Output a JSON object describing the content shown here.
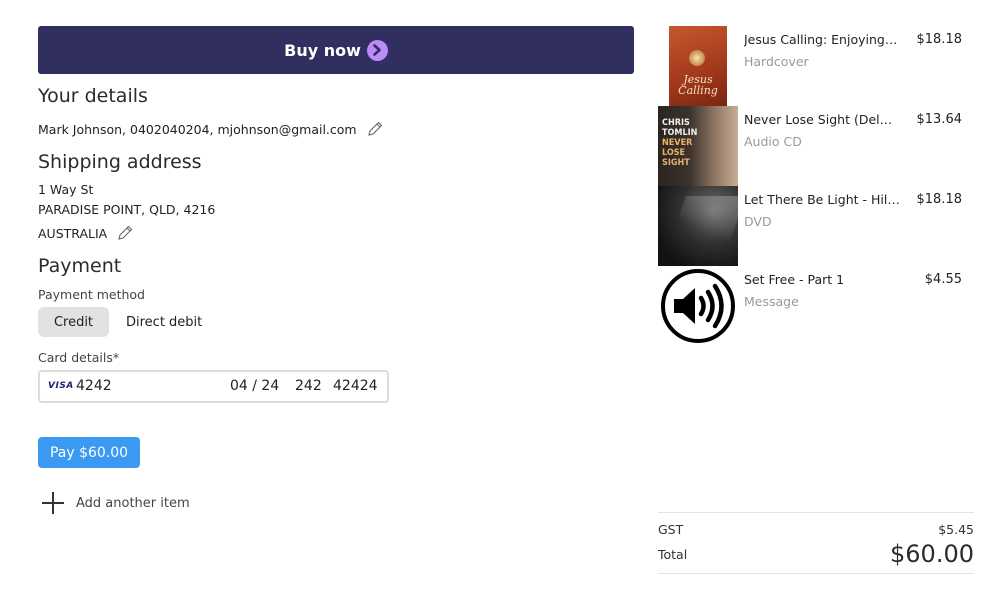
{
  "buy_button": {
    "label": "Buy now"
  },
  "details": {
    "title": "Your details",
    "contact": "Mark Johnson, 0402040204, mjohnson@gmail.com"
  },
  "shipping": {
    "title": "Shipping address",
    "line1": "1 Way St",
    "line2": "PARADISE POINT, QLD, 4216",
    "country": "AUSTRALIA"
  },
  "payment": {
    "title": "Payment",
    "method_label": "Payment method",
    "methods": [
      "Credit",
      "Direct debit"
    ],
    "selected_method": "Credit",
    "card_label": "Card details*",
    "card": {
      "brand": "VISA",
      "number": "4242",
      "expiry": "04 / 24",
      "cvc": "242",
      "postcode": "42424"
    },
    "pay_label": "Pay $60.00"
  },
  "add_item_label": "Add another item",
  "cart": {
    "items": [
      {
        "name": "Jesus Calling: Enjoying P...",
        "format": "Hardcover",
        "price": "$18.18"
      },
      {
        "name": "Never Lose Sight (Delux...",
        "format": "Audio CD",
        "price": "$13.64"
      },
      {
        "name": "Let There Be Light - Hills...",
        "format": "DVD",
        "price": "$18.18"
      },
      {
        "name": "Set Free - Part 1",
        "format": "Message",
        "price": "$4.55"
      }
    ],
    "gst_label": "GST",
    "gst_value": "$5.45",
    "total_label": "Total",
    "total_value": "$60.00",
    "cover_texts": {
      "jesus_calling": "Jesus Calling",
      "chris_tomlin": [
        "CHRIS",
        "TOMLIN",
        "NEVER",
        "LOSE",
        "SIGHT"
      ]
    }
  },
  "colors": {
    "buy_button_bg": "#312f60",
    "buy_button_chevron": "#b98cf7",
    "pay_button_bg": "#3a99f0",
    "selected_method_bg": "#e2e2e2"
  },
  "icons": {
    "buy_chevron": "chevron-right-icon",
    "edit": "pencil-icon",
    "add": "plus-icon",
    "audio_message": "speaker-icon"
  }
}
